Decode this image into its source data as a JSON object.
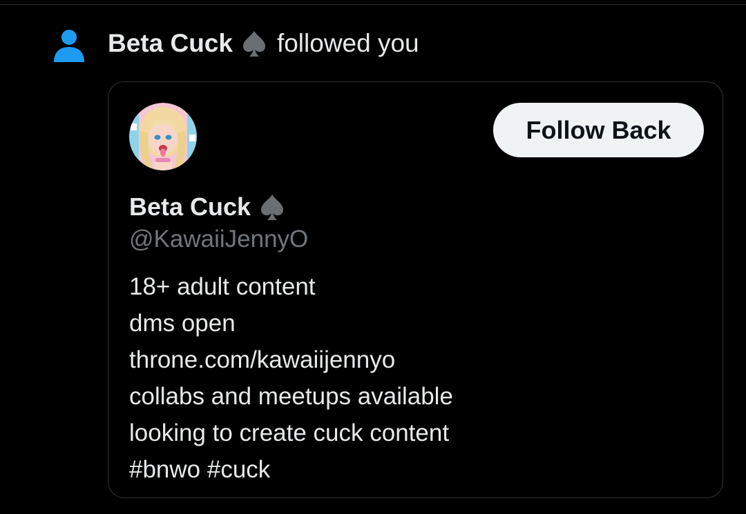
{
  "notification": {
    "icon": "person-icon",
    "icon_color": "#1d9bf0",
    "actor_name": "Beta Cuck",
    "actor_badge_icon": "spade-icon",
    "action_text": "followed you"
  },
  "profile_card": {
    "avatar": "profile-avatar",
    "display_name": "Beta Cuck",
    "badge_icon": "spade-icon",
    "handle": "@KawaiiJennyO",
    "follow_button_label": "Follow Back",
    "bio_lines": [
      "18+ adult content",
      "dms open",
      "throne.com/kawaiijennyo",
      "collabs and meetups available",
      "looking to create cuck content",
      "#bnwo #cuck"
    ]
  },
  "colors": {
    "background": "#000000",
    "text_primary": "#e7e9ea",
    "text_secondary": "#71767b",
    "border": "#2f3336",
    "button_bg": "#eff3f4",
    "button_text": "#0f1419"
  }
}
